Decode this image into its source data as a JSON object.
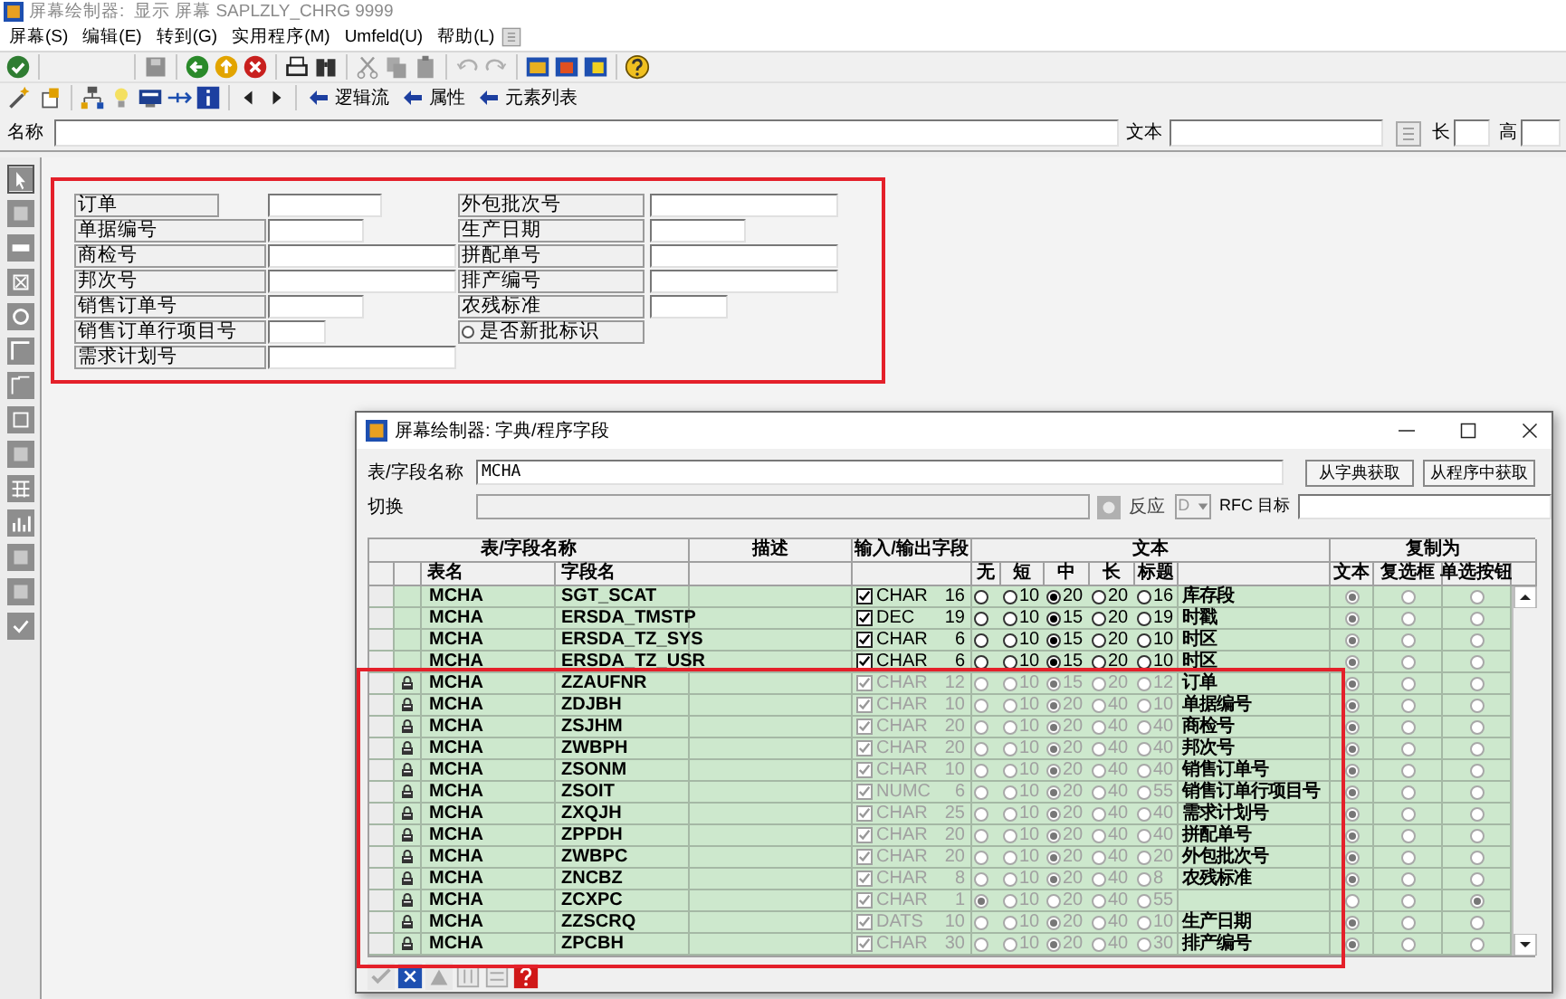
{
  "window": {
    "title": "屏幕绘制器:  显示 屏幕 SAPLZLY_CHRG 9999"
  },
  "menu": [
    "屏幕(S)",
    "编辑(E)",
    "转到(G)",
    "实用程序(M)",
    "Umfeld(U)",
    "帮助(L)"
  ],
  "toolbar_links": [
    "逻辑流",
    "属性",
    "元素列表"
  ],
  "name_row": {
    "name_label": "名称",
    "text_label": "文本",
    "length_label": "长",
    "height_label": "高"
  },
  "form": {
    "left": [
      {
        "kind": "field",
        "label": "订单"
      },
      {
        "kind": "field",
        "label": "单据编号"
      },
      {
        "kind": "field",
        "label": "商检号"
      },
      {
        "kind": "field",
        "label": "邦次号"
      },
      {
        "kind": "field",
        "label": "销售订单号"
      },
      {
        "kind": "field",
        "label": "销售订单行项目号"
      },
      {
        "kind": "field",
        "label": "需求计划号"
      }
    ],
    "right": [
      {
        "kind": "field",
        "label": "外包批次号"
      },
      {
        "kind": "field",
        "label": "生产日期"
      },
      {
        "kind": "field",
        "label": "拼配单号"
      },
      {
        "kind": "field",
        "label": "排产编号"
      },
      {
        "kind": "field",
        "label": "农残标准"
      },
      {
        "kind": "radio",
        "label": "是否新批标识",
        "selected": false
      }
    ]
  },
  "dialog": {
    "title": "屏幕绘制器: 字典/程序字段",
    "table_field_label": "表/字段名称",
    "table_field_value": "MCHA",
    "buttons": [
      "从字典获取",
      "从程序中获取"
    ],
    "switch_label": "切换",
    "reaction_label": "反应",
    "reaction_value": "D",
    "rfc_label": "RFC 目标",
    "table": {
      "group_headers": [
        "表/字段名称",
        "描述",
        "输入/输出字段",
        "文本",
        "复制为"
      ],
      "columns": [
        "表名",
        "字段名",
        "无",
        "短",
        "中",
        "长",
        "标题",
        "文本",
        "复选框",
        "单选按钮"
      ],
      "rows": [
        {
          "locked": false,
          "table": "MCHA",
          "field": "SGT_SCAT",
          "checked": true,
          "type": "CHAR",
          "length": "16",
          "text_options": [
            {
              "selected": false
            },
            {
              "label": "10",
              "selected": false
            },
            {
              "label": "20",
              "selected": true
            },
            {
              "label": "20",
              "selected": false
            },
            {
              "label": "16",
              "selected": false
            }
          ],
          "text": "库存段",
          "copy_as": [
            {
              "selected": true
            },
            {
              "selected": false
            },
            {
              "selected": false
            }
          ]
        },
        {
          "locked": false,
          "table": "MCHA",
          "field": "ERSDA_TMSTP",
          "checked": true,
          "type": "DEC",
          "length": "19",
          "text_options": [
            {
              "selected": false
            },
            {
              "label": "10",
              "selected": false
            },
            {
              "label": "15",
              "selected": true
            },
            {
              "label": "20",
              "selected": false
            },
            {
              "label": "19",
              "selected": false
            }
          ],
          "text": "时戳",
          "copy_as": [
            {
              "selected": true
            },
            {
              "selected": false
            },
            {
              "selected": false
            }
          ]
        },
        {
          "locked": false,
          "table": "MCHA",
          "field": "ERSDA_TZ_SYS",
          "checked": true,
          "type": "CHAR",
          "length": "6",
          "text_options": [
            {
              "selected": false
            },
            {
              "label": "10",
              "selected": false
            },
            {
              "label": "15",
              "selected": true
            },
            {
              "label": "20",
              "selected": false
            },
            {
              "label": "10",
              "selected": false
            }
          ],
          "text": "时区",
          "copy_as": [
            {
              "selected": true
            },
            {
              "selected": false
            },
            {
              "selected": false
            }
          ]
        },
        {
          "locked": false,
          "table": "MCHA",
          "field": "ERSDA_TZ_USR",
          "checked": true,
          "type": "CHAR",
          "length": "6",
          "text_options": [
            {
              "selected": false
            },
            {
              "label": "10",
              "selected": false
            },
            {
              "label": "15",
              "selected": true
            },
            {
              "label": "20",
              "selected": false
            },
            {
              "label": "10",
              "selected": false
            }
          ],
          "text": "时区",
          "copy_as": [
            {
              "selected": true
            },
            {
              "selected": false
            },
            {
              "selected": false
            }
          ]
        },
        {
          "locked": true,
          "table": "MCHA",
          "field": "ZZAUFNR",
          "checked": true,
          "type": "CHAR",
          "length": "12",
          "text_options": [
            {
              "selected": false
            },
            {
              "label": "10",
              "selected": false
            },
            {
              "label": "15",
              "selected": true
            },
            {
              "label": "20",
              "selected": false
            },
            {
              "label": "12",
              "selected": false
            }
          ],
          "text": "订单",
          "copy_as": [
            {
              "selected": true
            },
            {
              "selected": false
            },
            {
              "selected": false
            }
          ]
        },
        {
          "locked": true,
          "table": "MCHA",
          "field": "ZDJBH",
          "checked": true,
          "type": "CHAR",
          "length": "10",
          "text_options": [
            {
              "selected": false
            },
            {
              "label": "10",
              "selected": false
            },
            {
              "label": "20",
              "selected": true
            },
            {
              "label": "40",
              "selected": false
            },
            {
              "label": "10",
              "selected": false
            }
          ],
          "text": "单据编号",
          "copy_as": [
            {
              "selected": true
            },
            {
              "selected": false
            },
            {
              "selected": false
            }
          ]
        },
        {
          "locked": true,
          "table": "MCHA",
          "field": "ZSJHM",
          "checked": true,
          "type": "CHAR",
          "length": "20",
          "text_options": [
            {
              "selected": false
            },
            {
              "label": "10",
              "selected": false
            },
            {
              "label": "20",
              "selected": true
            },
            {
              "label": "40",
              "selected": false
            },
            {
              "label": "40",
              "selected": false
            }
          ],
          "text": "商检号",
          "copy_as": [
            {
              "selected": true
            },
            {
              "selected": false
            },
            {
              "selected": false
            }
          ]
        },
        {
          "locked": true,
          "table": "MCHA",
          "field": "ZWBPH",
          "checked": true,
          "type": "CHAR",
          "length": "20",
          "text_options": [
            {
              "selected": false
            },
            {
              "label": "10",
              "selected": false
            },
            {
              "label": "20",
              "selected": true
            },
            {
              "label": "40",
              "selected": false
            },
            {
              "label": "40",
              "selected": false
            }
          ],
          "text": "邦次号",
          "copy_as": [
            {
              "selected": true
            },
            {
              "selected": false
            },
            {
              "selected": false
            }
          ]
        },
        {
          "locked": true,
          "table": "MCHA",
          "field": "ZSONM",
          "checked": true,
          "type": "CHAR",
          "length": "10",
          "text_options": [
            {
              "selected": false
            },
            {
              "label": "10",
              "selected": false
            },
            {
              "label": "20",
              "selected": true
            },
            {
              "label": "40",
              "selected": false
            },
            {
              "label": "40",
              "selected": false
            }
          ],
          "text": "销售订单号",
          "copy_as": [
            {
              "selected": true
            },
            {
              "selected": false
            },
            {
              "selected": false
            }
          ]
        },
        {
          "locked": true,
          "table": "MCHA",
          "field": "ZSOIT",
          "checked": true,
          "type": "NUMC",
          "length": "6",
          "text_options": [
            {
              "selected": false
            },
            {
              "label": "10",
              "selected": false
            },
            {
              "label": "20",
              "selected": true
            },
            {
              "label": "40",
              "selected": false
            },
            {
              "label": "55",
              "selected": false
            }
          ],
          "text": "销售订单行项目号",
          "copy_as": [
            {
              "selected": true
            },
            {
              "selected": false
            },
            {
              "selected": false
            }
          ]
        },
        {
          "locked": true,
          "table": "MCHA",
          "field": "ZXQJH",
          "checked": true,
          "type": "CHAR",
          "length": "25",
          "text_options": [
            {
              "selected": false
            },
            {
              "label": "10",
              "selected": false
            },
            {
              "label": "20",
              "selected": true
            },
            {
              "label": "40",
              "selected": false
            },
            {
              "label": "40",
              "selected": false
            }
          ],
          "text": "需求计划号",
          "copy_as": [
            {
              "selected": true
            },
            {
              "selected": false
            },
            {
              "selected": false
            }
          ]
        },
        {
          "locked": true,
          "table": "MCHA",
          "field": "ZPPDH",
          "checked": true,
          "type": "CHAR",
          "length": "20",
          "text_options": [
            {
              "selected": false
            },
            {
              "label": "10",
              "selected": false
            },
            {
              "label": "20",
              "selected": true
            },
            {
              "label": "40",
              "selected": false
            },
            {
              "label": "40",
              "selected": false
            }
          ],
          "text": "拼配单号",
          "copy_as": [
            {
              "selected": true
            },
            {
              "selected": false
            },
            {
              "selected": false
            }
          ]
        },
        {
          "locked": true,
          "table": "MCHA",
          "field": "ZWBPC",
          "checked": true,
          "type": "CHAR",
          "length": "20",
          "text_options": [
            {
              "selected": false
            },
            {
              "label": "10",
              "selected": false
            },
            {
              "label": "20",
              "selected": true
            },
            {
              "label": "40",
              "selected": false
            },
            {
              "label": "20",
              "selected": false
            }
          ],
          "text": "外包批次号",
          "copy_as": [
            {
              "selected": true
            },
            {
              "selected": false
            },
            {
              "selected": false
            }
          ]
        },
        {
          "locked": true,
          "table": "MCHA",
          "field": "ZNCBZ",
          "checked": true,
          "type": "CHAR",
          "length": "8",
          "text_options": [
            {
              "selected": false
            },
            {
              "label": "10",
              "selected": false
            },
            {
              "label": "20",
              "selected": true
            },
            {
              "label": "40",
              "selected": false
            },
            {
              "label": "8",
              "selected": false
            }
          ],
          "text": "农残标准",
          "copy_as": [
            {
              "selected": true
            },
            {
              "selected": false
            },
            {
              "selected": false
            }
          ]
        },
        {
          "locked": true,
          "table": "MCHA",
          "field": "ZCXPC",
          "checked": true,
          "type": "CHAR",
          "length": "1",
          "text_options": [
            {
              "selected": true
            },
            {
              "label": "10",
              "selected": false
            },
            {
              "label": "20",
              "selected": false
            },
            {
              "label": "40",
              "selected": false
            },
            {
              "label": "55",
              "selected": false
            }
          ],
          "copy_as": [
            {
              "selected": false
            },
            {
              "selected": false
            },
            {
              "selected": true
            }
          ]
        },
        {
          "locked": true,
          "table": "MCHA",
          "field": "ZZSCRQ",
          "checked": true,
          "type": "DATS",
          "length": "10",
          "text_options": [
            {
              "selected": false
            },
            {
              "label": "10",
              "selected": false
            },
            {
              "label": "20",
              "selected": true
            },
            {
              "label": "40",
              "selected": false
            },
            {
              "label": "10",
              "selected": false
            }
          ],
          "text": "生产日期",
          "copy_as": [
            {
              "selected": true
            },
            {
              "selected": false
            },
            {
              "selected": false
            }
          ]
        },
        {
          "locked": true,
          "table": "MCHA",
          "field": "ZPCBH",
          "checked": true,
          "type": "CHAR",
          "length": "30",
          "text_options": [
            {
              "selected": false
            },
            {
              "label": "10",
              "selected": false
            },
            {
              "label": "20",
              "selected": true
            },
            {
              "label": "40",
              "selected": false
            },
            {
              "label": "30",
              "selected": false
            }
          ],
          "text": "排产编号",
          "copy_as": [
            {
              "selected": true
            },
            {
              "selected": false
            },
            {
              "selected": false
            }
          ]
        }
      ]
    }
  }
}
